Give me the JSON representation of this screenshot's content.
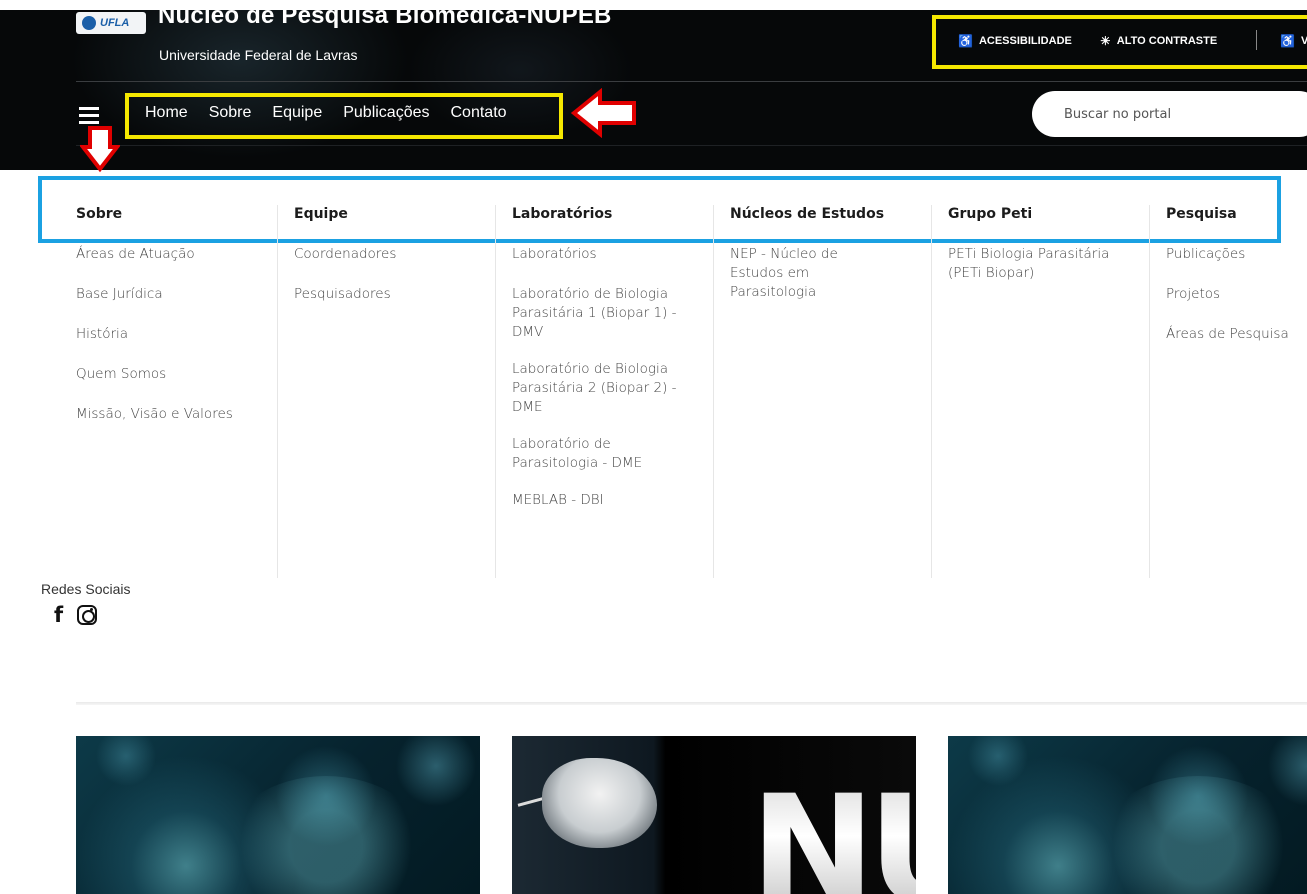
{
  "header": {
    "logo_text": "UFLA",
    "title": "Núcleo de Pesquisa Biomédica-NUPEB",
    "subtitle": "Universidade Federal de Lavras"
  },
  "accessibility": {
    "items": [
      {
        "label": "ACESSIBILIDADE",
        "icon": "accessibility-icon"
      },
      {
        "label": "ALTO CONTRASTE",
        "icon": "contrast-sun-icon"
      },
      {
        "label": "V",
        "icon": "accessibility-icon"
      }
    ]
  },
  "nav": {
    "items": [
      "Home",
      "Sobre",
      "Equipe",
      "Publicações",
      "Contato"
    ]
  },
  "search": {
    "placeholder": "Buscar no portal"
  },
  "annotations": {
    "highlight_color": "#f5e800",
    "menu_highlight_color": "#1ba1e2",
    "arrow_color": "#e00000"
  },
  "mega_menu": {
    "columns": [
      {
        "title": "Sobre",
        "items": [
          "Áreas de Atuação",
          "Base Jurídica",
          "História",
          "Quem Somos",
          "Missão, Visão e Valores"
        ]
      },
      {
        "title": "Equipe",
        "items": [
          "Coordenadores",
          "Pesquisadores"
        ]
      },
      {
        "title": "Laboratórios",
        "items": [
          "Laboratórios",
          "Laboratório de Biologia Parasitária 1 (Biopar 1) - DMV",
          "Laboratório de Biologia Parasitária 2 (Biopar 2) - DME",
          "Laboratório de Parasitologia - DME",
          "MEBLAB - DBI"
        ]
      },
      {
        "title": "Núcleos de Estudos",
        "items": [
          "NEP - Núcleo de Estudos em Parasitologia"
        ]
      },
      {
        "title": "Grupo Peti",
        "items": [
          "PETi Biologia Parasitária (PETi Biopar)"
        ]
      },
      {
        "title": "Pesquisa",
        "items": [
          "Publicações",
          "Projetos",
          "Áreas de Pesquisa"
        ]
      }
    ]
  },
  "social": {
    "label": "Redes Sociais",
    "facebook_glyph": "f",
    "icons": [
      "facebook-icon",
      "instagram-icon"
    ]
  },
  "cards": {
    "nupeb_text": "NU"
  }
}
